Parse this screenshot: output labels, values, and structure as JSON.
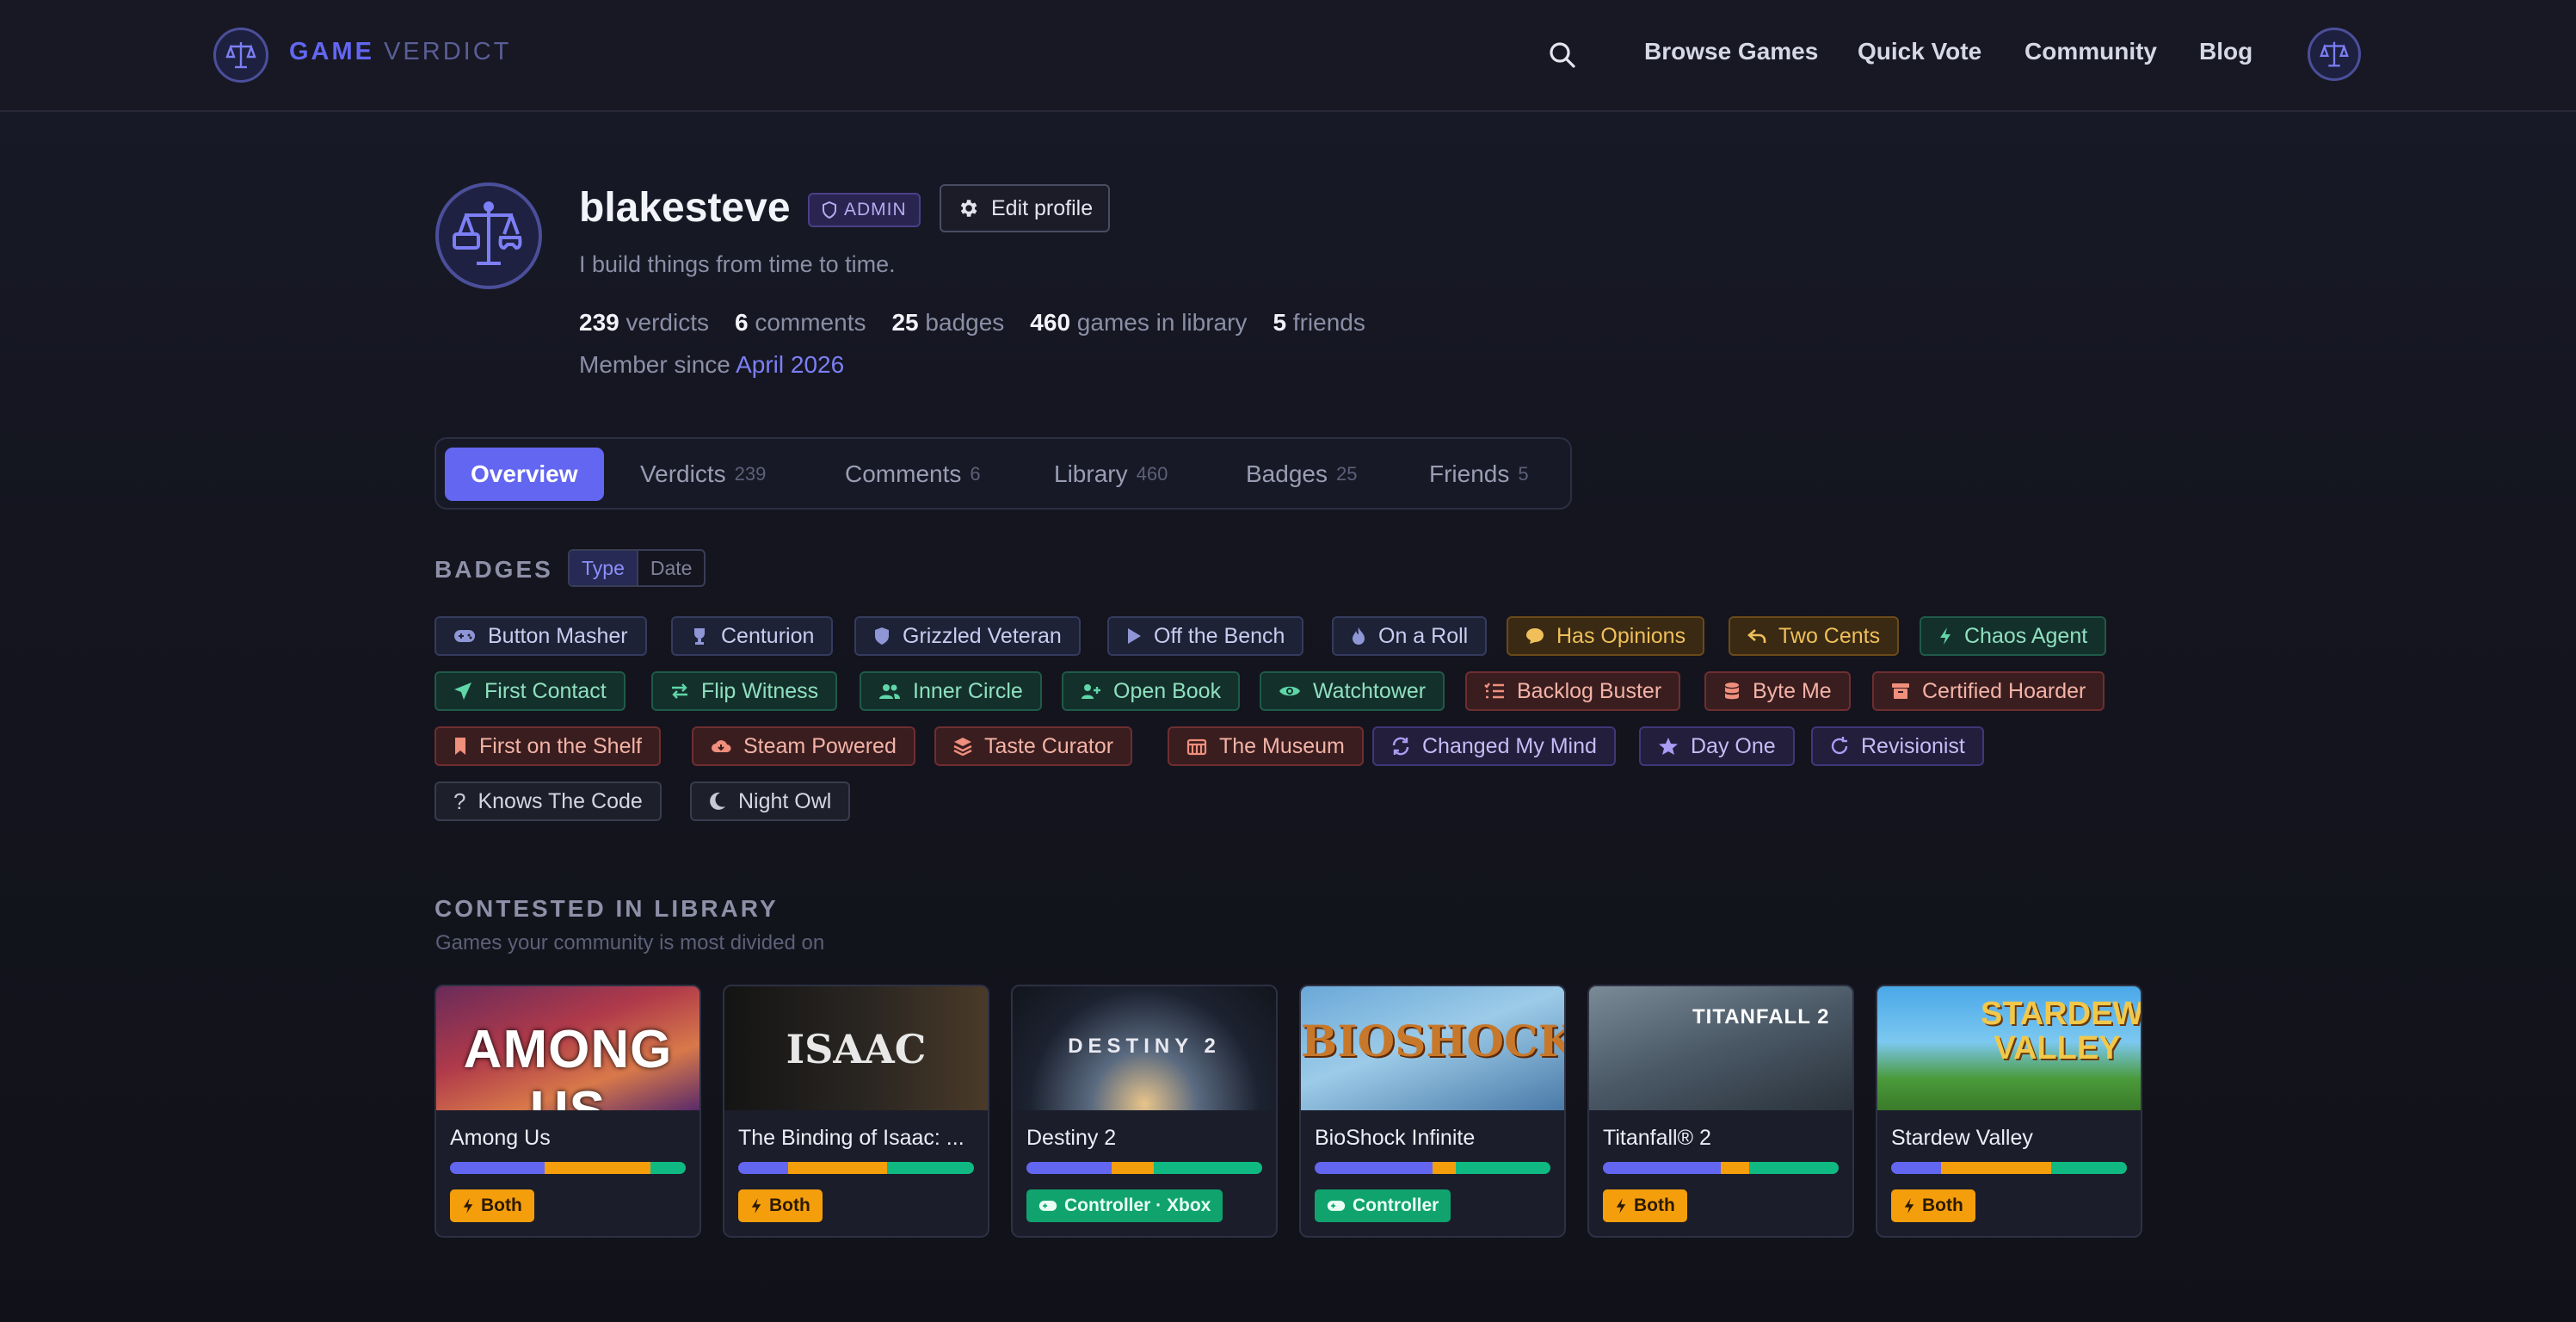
{
  "brand": {
    "name_bold": "GAME",
    "name_light": "VERDICT"
  },
  "nav": [
    "Browse Games",
    "Quick Vote",
    "Community",
    "Blog"
  ],
  "profile": {
    "username": "blakesteve",
    "role": "ADMIN",
    "edit_label": "Edit profile",
    "bio": "I build things from time to time.",
    "stats": [
      {
        "value": "239",
        "label": "verdicts"
      },
      {
        "value": "6",
        "label": "comments"
      },
      {
        "value": "25",
        "label": "badges"
      },
      {
        "value": "460",
        "label": "games in library"
      },
      {
        "value": "5",
        "label": "friends"
      }
    ],
    "member_prefix": "Member since",
    "member_date": "April 2026"
  },
  "tabs": [
    {
      "label": "Overview",
      "count": ""
    },
    {
      "label": "Verdicts",
      "count": "239"
    },
    {
      "label": "Comments",
      "count": "6"
    },
    {
      "label": "Library",
      "count": "460"
    },
    {
      "label": "Badges",
      "count": "25"
    },
    {
      "label": "Friends",
      "count": "5"
    }
  ],
  "badges_section": {
    "title": "BADGES",
    "sort_options": [
      "Type",
      "Date"
    ],
    "badges": [
      "Button Masher",
      "Centurion",
      "Grizzled Veteran",
      "Off the Bench",
      "On a Roll",
      "Has Opinions",
      "Two Cents",
      "Chaos Agent",
      "First Contact",
      "Flip Witness",
      "Inner Circle",
      "Open Book",
      "Watchtower",
      "Backlog Buster",
      "Byte Me",
      "Certified Hoarder",
      "First on the Shelf",
      "Steam Powered",
      "Taste Curator",
      "The Museum",
      "Changed My Mind",
      "Day One",
      "Revisionist",
      "Knows The Code",
      "Night Owl"
    ]
  },
  "contested": {
    "title": "CONTESTED IN LIBRARY",
    "subtitle": "Games your community is most divided on",
    "games": [
      {
        "name": "Among Us",
        "cover_text": "AMONG US",
        "split": [
          0.4,
          0.45,
          0.15
        ],
        "tag": "Both"
      },
      {
        "name": "The Binding of Isaac: ...",
        "cover_text": "ISAAC",
        "split": [
          0.21,
          0.42,
          0.37
        ],
        "tag": "Both"
      },
      {
        "name": "Destiny 2",
        "cover_text": "DESTINY 2",
        "split": [
          0.36,
          0.18,
          0.46
        ],
        "tag": "Controller · Xbox"
      },
      {
        "name": "BioShock Infinite",
        "cover_text": "BIOSHOCK",
        "split": [
          0.5,
          0.1,
          0.4
        ],
        "tag": "Controller"
      },
      {
        "name": "Titanfall® 2",
        "cover_text": "TITANFALL 2",
        "split": [
          0.5,
          0.12,
          0.38
        ],
        "tag": "Both"
      },
      {
        "name": "Stardew Valley",
        "cover_text": "STARDEW VALLEY",
        "split": [
          0.21,
          0.47,
          0.32
        ],
        "tag": "Both"
      }
    ]
  },
  "colors": {
    "accent": "#6366f1",
    "bar_blue": "#6366f1",
    "bar_amber": "#f59e0b",
    "bar_green": "#10b981"
  }
}
